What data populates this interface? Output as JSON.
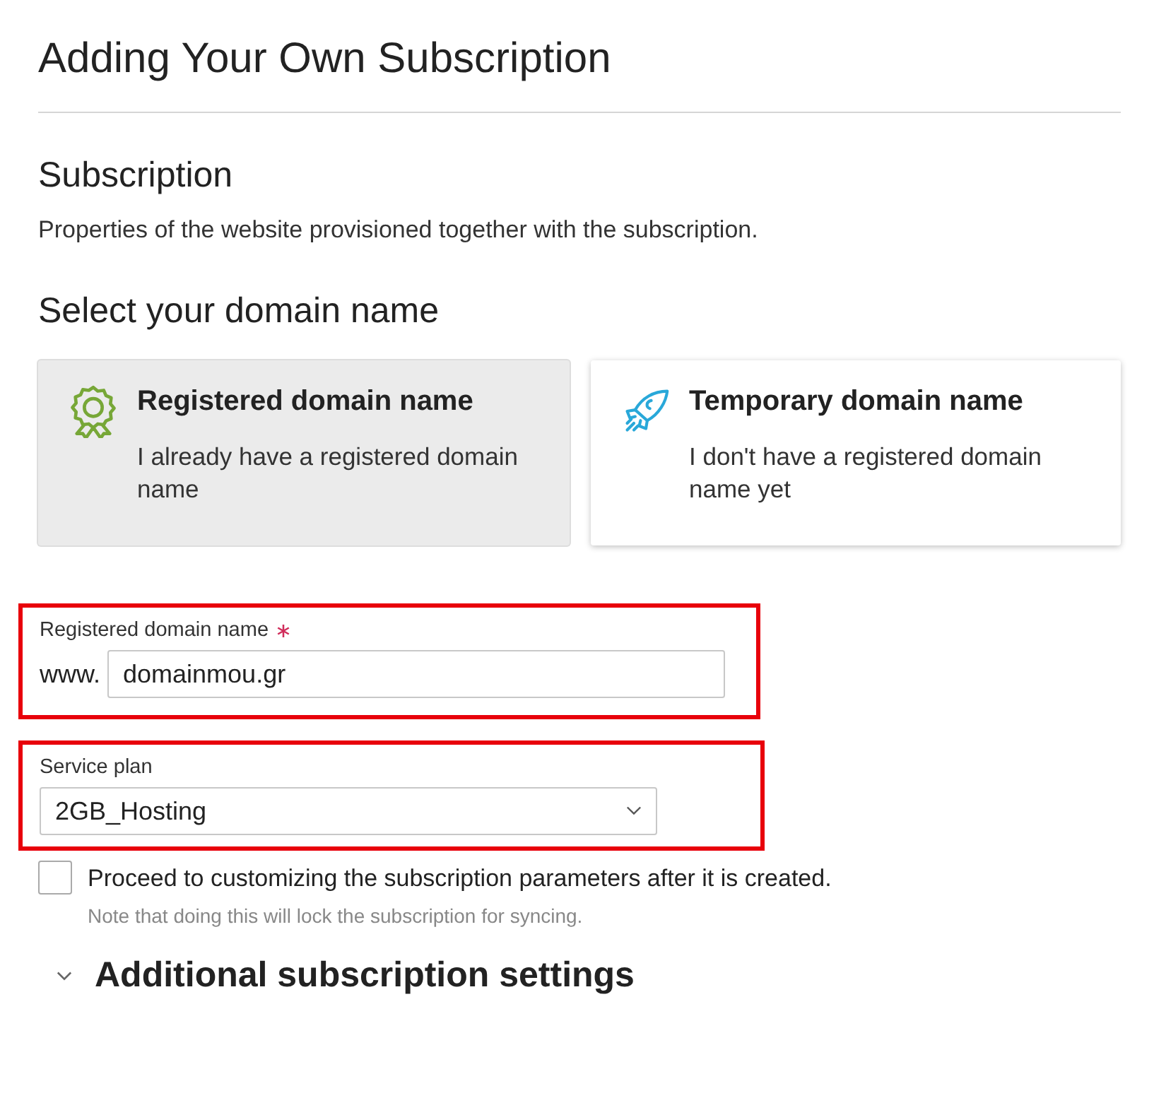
{
  "page_title": "Adding Your Own Subscription",
  "section": {
    "title": "Subscription",
    "description": "Properties of the website provisioned together with the subscription."
  },
  "domain_choice": {
    "title": "Select your domain name",
    "options": [
      {
        "kind": "registered",
        "title": "Registered domain name",
        "description": "I already have a registered domain name",
        "selected": true
      },
      {
        "kind": "temporary",
        "title": "Temporary domain name",
        "description": "I don't have a registered domain name yet",
        "selected": false
      }
    ]
  },
  "domain_field": {
    "label": "Registered domain name",
    "required": true,
    "prefix": "www.",
    "value": "domainmou.gr",
    "highlighted": true
  },
  "service_plan": {
    "label": "Service plan",
    "value": "2GB_Hosting",
    "highlighted": true
  },
  "customize_option": {
    "label": "Proceed to customizing the subscription parameters after it is created.",
    "note": "Note that doing this will lock the subscription for syncing.",
    "checked": false
  },
  "additional_settings": {
    "title": "Additional subscription settings",
    "expanded": false
  }
}
